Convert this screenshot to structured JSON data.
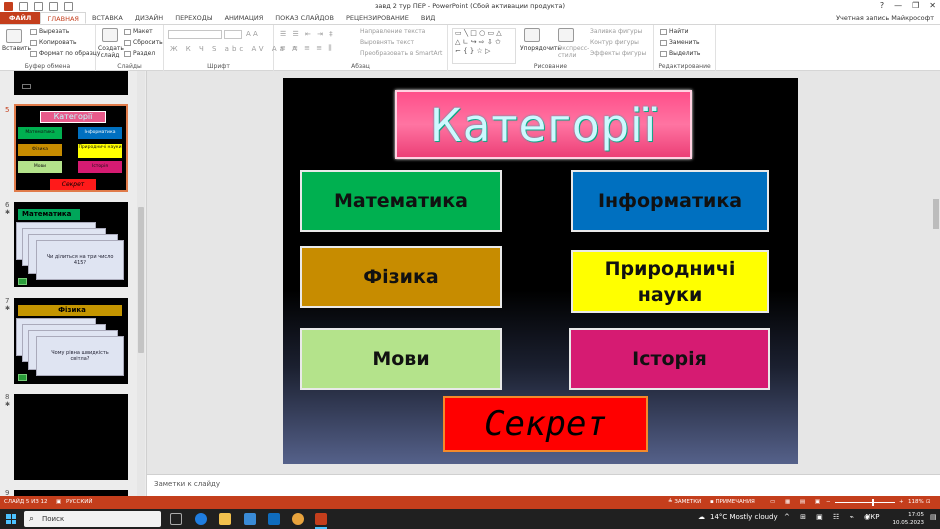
{
  "window": {
    "title": "завд 2 тур ПЕР - PowerPoint (Сбой активации продукта)",
    "account": "Учетная запись Майкрософт",
    "controls": [
      "?",
      "—",
      "❐",
      "✕"
    ]
  },
  "tabs": [
    "ФАЙЛ",
    "ГЛАВНАЯ",
    "ВСТАВКА",
    "ДИЗАЙН",
    "ПЕРЕХОДЫ",
    "АНИМАЦИЯ",
    "ПОКАЗ СЛАЙДОВ",
    "РЕЦЕНЗИРОВАНИЕ",
    "ВИД"
  ],
  "ribbon": {
    "clipboard": {
      "paste": "Вставить",
      "cut": "Вырезать",
      "copy": "Копировать",
      "format_painter": "Формат по образцу",
      "label": "Буфер обмена"
    },
    "slides": {
      "new_slide": "Создать слайд",
      "layout": "Макет",
      "reset": "Сбросить",
      "section": "Раздел",
      "label": "Слайды"
    },
    "font": {
      "label": "Шрифт"
    },
    "paragraph": {
      "text_direction": "Направление текста",
      "align_text": "Выровнять текст",
      "smartart": "Преобразовать в SmartArt",
      "label": "Абзац"
    },
    "drawing": {
      "arrange": "Упорядочить",
      "quick_styles": "Экспресс-стили",
      "shape_fill": "Заливка фигуры",
      "shape_outline": "Контур фигуры",
      "shape_effects": "Эффекты фигуры",
      "label": "Рисование"
    },
    "editing": {
      "find": "Найти",
      "replace": "Заменить",
      "select": "Выделить",
      "label": "Редактирование"
    }
  },
  "thumbnails": {
    "numbers": [
      "5",
      "6",
      "7",
      "8",
      "9"
    ],
    "slide5": {
      "title": "Категорії",
      "items": [
        "Математика",
        "Інформатика",
        "Фізика",
        "Природничі науки",
        "Мови",
        "Історія"
      ],
      "secret": "Секрет"
    },
    "slide6": {
      "heading": "Математика",
      "question": "Чи ділиться на три число 415?"
    },
    "slide7": {
      "heading": "Фізика",
      "question": "Чому рівна швидкість світла?"
    }
  },
  "slide": {
    "title": "Категорії",
    "categories": [
      {
        "label": "Математика",
        "color": "#00b050"
      },
      {
        "label": "Інформатика",
        "color": "#0070c0"
      },
      {
        "label": "Фізика",
        "color": "#c78c00"
      },
      {
        "label": "Природничі науки",
        "color": "#ffff00"
      },
      {
        "label": "Мови",
        "color": "#b4e38b"
      },
      {
        "label": "Історія",
        "color": "#d61b72"
      }
    ],
    "secret": "Секрет"
  },
  "notes_placeholder": "Заметки к слайду",
  "status": {
    "slide_counter": "СЛАЙД 5 ИЗ 12",
    "language": "РУССКИЙ",
    "notes": "ЗАМЕТКИ",
    "comments": "ПРИМЕЧАНИЯ",
    "zoom": "118%"
  },
  "taskbar": {
    "search": "Поиск",
    "weather": "14°C  Mostly cloudy",
    "lang": "УКР",
    "time": "17:05",
    "date": "10.05.2023"
  }
}
